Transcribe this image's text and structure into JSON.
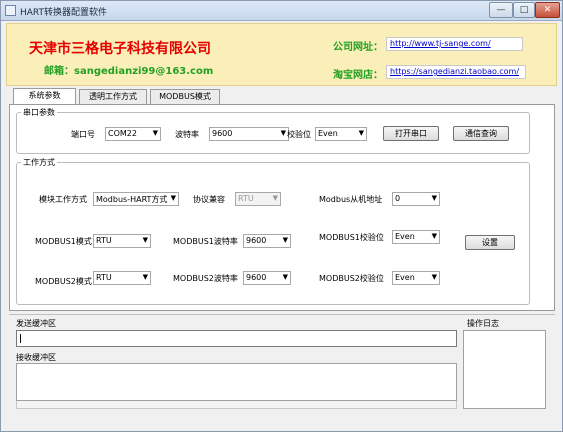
{
  "window": {
    "title": "HART转换器配置软件",
    "min_label": "—",
    "max_label": "□",
    "close_label": "✕"
  },
  "banner": {
    "company": "天津市三格电子科技有限公司",
    "email": "邮箱：sangedianzi99@163.com",
    "site_label": "公司网址：",
    "site_url": "http://www.tj-sange.com/",
    "shop_label": "淘宝网店：",
    "shop_url": "https://sangedianzi.taobao.com/"
  },
  "tabs": [
    "系统参数",
    "透明工作方式",
    "MODBUS模式"
  ],
  "serial": {
    "group_title": "串口参数",
    "port_label": "端口号",
    "port_value": "COM22",
    "baud_label": "波特率",
    "baud_value": "9600",
    "parity_label": "校验位",
    "parity_value": "Even",
    "open_button": "打开串口",
    "query_button": "通信查询"
  },
  "work": {
    "group_title": "工作方式",
    "mode_label": "模块工作方式",
    "mode_value": "Modbus-HART方式",
    "compat_label": "协议兼容",
    "compat_value": "RTU",
    "slave_label": "Modbus从机地址",
    "slave_value": "0",
    "m1_mode_label": "MODBUS1模式",
    "m1_mode_value": "RTU",
    "m1_baud_label": "MODBUS1波特率",
    "m1_baud_value": "9600",
    "m1_parity_label": "MODBUS1校验位",
    "m1_parity_value": "Even",
    "set_button": "设置",
    "m2_mode_label": "MODBUS2模式",
    "m2_mode_value": "RTU",
    "m2_baud_label": "MODBUS2波特率",
    "m2_baud_value": "9600",
    "m2_parity_label": "MODBUS2校验位",
    "m2_parity_value": "Even"
  },
  "buffers": {
    "send_title": "发送缓冲区",
    "recv_title": "接收缓冲区",
    "log_title": "操作日志"
  },
  "icons": {
    "dropdown": "▼"
  },
  "colors": {
    "banner_bg": "#fbefb9",
    "company_red": "#e50000",
    "label_green": "#22a022",
    "link_blue": "#0000cc"
  }
}
